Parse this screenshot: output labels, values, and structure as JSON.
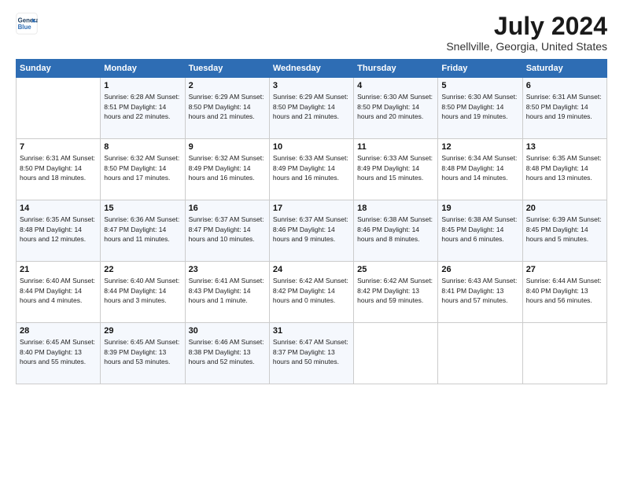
{
  "logo": {
    "line1": "General",
    "line2": "Blue"
  },
  "title": "July 2024",
  "subtitle": "Snellville, Georgia, United States",
  "weekdays": [
    "Sunday",
    "Monday",
    "Tuesday",
    "Wednesday",
    "Thursday",
    "Friday",
    "Saturday"
  ],
  "weeks": [
    [
      {
        "day": "",
        "info": ""
      },
      {
        "day": "1",
        "info": "Sunrise: 6:28 AM\nSunset: 8:51 PM\nDaylight: 14 hours\nand 22 minutes."
      },
      {
        "day": "2",
        "info": "Sunrise: 6:29 AM\nSunset: 8:50 PM\nDaylight: 14 hours\nand 21 minutes."
      },
      {
        "day": "3",
        "info": "Sunrise: 6:29 AM\nSunset: 8:50 PM\nDaylight: 14 hours\nand 21 minutes."
      },
      {
        "day": "4",
        "info": "Sunrise: 6:30 AM\nSunset: 8:50 PM\nDaylight: 14 hours\nand 20 minutes."
      },
      {
        "day": "5",
        "info": "Sunrise: 6:30 AM\nSunset: 8:50 PM\nDaylight: 14 hours\nand 19 minutes."
      },
      {
        "day": "6",
        "info": "Sunrise: 6:31 AM\nSunset: 8:50 PM\nDaylight: 14 hours\nand 19 minutes."
      }
    ],
    [
      {
        "day": "7",
        "info": "Sunrise: 6:31 AM\nSunset: 8:50 PM\nDaylight: 14 hours\nand 18 minutes."
      },
      {
        "day": "8",
        "info": "Sunrise: 6:32 AM\nSunset: 8:50 PM\nDaylight: 14 hours\nand 17 minutes."
      },
      {
        "day": "9",
        "info": "Sunrise: 6:32 AM\nSunset: 8:49 PM\nDaylight: 14 hours\nand 16 minutes."
      },
      {
        "day": "10",
        "info": "Sunrise: 6:33 AM\nSunset: 8:49 PM\nDaylight: 14 hours\nand 16 minutes."
      },
      {
        "day": "11",
        "info": "Sunrise: 6:33 AM\nSunset: 8:49 PM\nDaylight: 14 hours\nand 15 minutes."
      },
      {
        "day": "12",
        "info": "Sunrise: 6:34 AM\nSunset: 8:48 PM\nDaylight: 14 hours\nand 14 minutes."
      },
      {
        "day": "13",
        "info": "Sunrise: 6:35 AM\nSunset: 8:48 PM\nDaylight: 14 hours\nand 13 minutes."
      }
    ],
    [
      {
        "day": "14",
        "info": "Sunrise: 6:35 AM\nSunset: 8:48 PM\nDaylight: 14 hours\nand 12 minutes."
      },
      {
        "day": "15",
        "info": "Sunrise: 6:36 AM\nSunset: 8:47 PM\nDaylight: 14 hours\nand 11 minutes."
      },
      {
        "day": "16",
        "info": "Sunrise: 6:37 AM\nSunset: 8:47 PM\nDaylight: 14 hours\nand 10 minutes."
      },
      {
        "day": "17",
        "info": "Sunrise: 6:37 AM\nSunset: 8:46 PM\nDaylight: 14 hours\nand 9 minutes."
      },
      {
        "day": "18",
        "info": "Sunrise: 6:38 AM\nSunset: 8:46 PM\nDaylight: 14 hours\nand 8 minutes."
      },
      {
        "day": "19",
        "info": "Sunrise: 6:38 AM\nSunset: 8:45 PM\nDaylight: 14 hours\nand 6 minutes."
      },
      {
        "day": "20",
        "info": "Sunrise: 6:39 AM\nSunset: 8:45 PM\nDaylight: 14 hours\nand 5 minutes."
      }
    ],
    [
      {
        "day": "21",
        "info": "Sunrise: 6:40 AM\nSunset: 8:44 PM\nDaylight: 14 hours\nand 4 minutes."
      },
      {
        "day": "22",
        "info": "Sunrise: 6:40 AM\nSunset: 8:44 PM\nDaylight: 14 hours\nand 3 minutes."
      },
      {
        "day": "23",
        "info": "Sunrise: 6:41 AM\nSunset: 8:43 PM\nDaylight: 14 hours\nand 1 minute."
      },
      {
        "day": "24",
        "info": "Sunrise: 6:42 AM\nSunset: 8:42 PM\nDaylight: 14 hours\nand 0 minutes."
      },
      {
        "day": "25",
        "info": "Sunrise: 6:42 AM\nSunset: 8:42 PM\nDaylight: 13 hours\nand 59 minutes."
      },
      {
        "day": "26",
        "info": "Sunrise: 6:43 AM\nSunset: 8:41 PM\nDaylight: 13 hours\nand 57 minutes."
      },
      {
        "day": "27",
        "info": "Sunrise: 6:44 AM\nSunset: 8:40 PM\nDaylight: 13 hours\nand 56 minutes."
      }
    ],
    [
      {
        "day": "28",
        "info": "Sunrise: 6:45 AM\nSunset: 8:40 PM\nDaylight: 13 hours\nand 55 minutes."
      },
      {
        "day": "29",
        "info": "Sunrise: 6:45 AM\nSunset: 8:39 PM\nDaylight: 13 hours\nand 53 minutes."
      },
      {
        "day": "30",
        "info": "Sunrise: 6:46 AM\nSunset: 8:38 PM\nDaylight: 13 hours\nand 52 minutes."
      },
      {
        "day": "31",
        "info": "Sunrise: 6:47 AM\nSunset: 8:37 PM\nDaylight: 13 hours\nand 50 minutes."
      },
      {
        "day": "",
        "info": ""
      },
      {
        "day": "",
        "info": ""
      },
      {
        "day": "",
        "info": ""
      }
    ]
  ]
}
